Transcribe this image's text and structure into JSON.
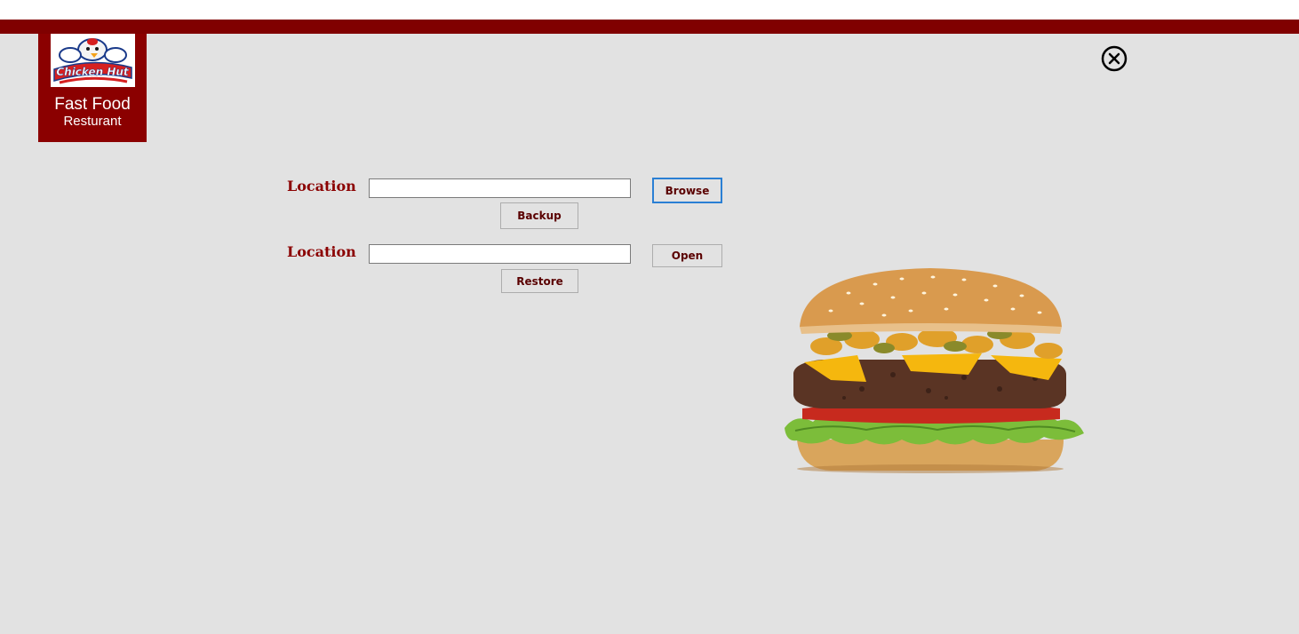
{
  "header": {
    "accent_color": "#800000"
  },
  "logo": {
    "brand_text": "Chicken Hut",
    "title": "Fast Food",
    "subtitle": "Resturant"
  },
  "close_icon": "close-circle-icon",
  "backup": {
    "label": "Location",
    "input_value": "",
    "browse_label": "Browse",
    "action_label": "Backup"
  },
  "restore": {
    "label": "Location",
    "input_value": "",
    "open_label": "Open",
    "action_label": "Restore"
  },
  "image": {
    "subject": "burger-image"
  }
}
